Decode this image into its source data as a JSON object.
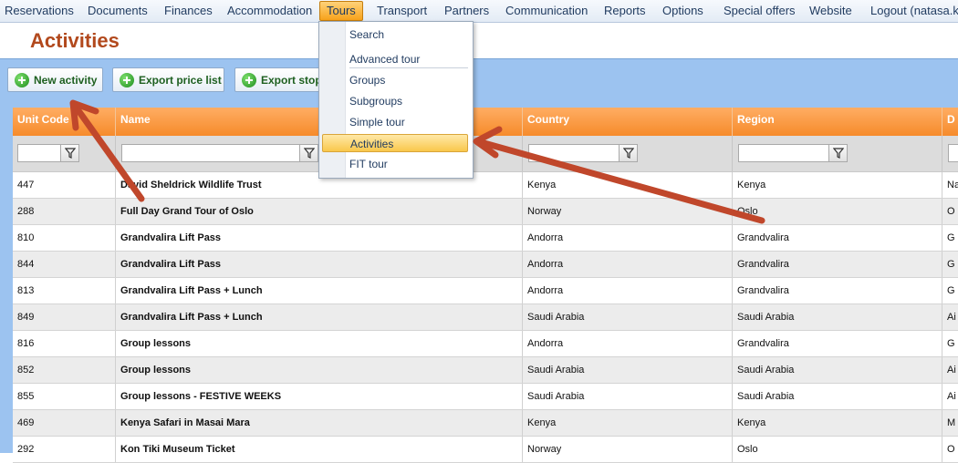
{
  "menu": {
    "items": [
      {
        "label": "Reservations"
      },
      {
        "label": "Documents"
      },
      {
        "label": "Finances"
      },
      {
        "label": "Accommodation"
      },
      {
        "label": "Tours"
      },
      {
        "label": "Transport"
      },
      {
        "label": "Partners"
      },
      {
        "label": "Communication"
      },
      {
        "label": "Reports"
      },
      {
        "label": "Options"
      },
      {
        "label": "Special offers"
      },
      {
        "label": "Website"
      },
      {
        "label": "Logout (natasa.kap"
      }
    ],
    "active": "Tours"
  },
  "page": {
    "title": "Activities"
  },
  "toolbar": {
    "new_activity": "New activity",
    "export_price_list": "Export price list",
    "export_stop": "Export stop"
  },
  "table": {
    "headers": [
      "Unit Code",
      "Name",
      "Country",
      "Region",
      "D"
    ],
    "rows": [
      [
        "447",
        "David Sheldrick Wildlife Trust",
        "Kenya",
        "Kenya",
        "Na"
      ],
      [
        "288",
        "Full Day Grand Tour of Oslo",
        "Norway",
        "Oslo",
        "O"
      ],
      [
        "810",
        "Grandvalira Lift Pass",
        "Andorra",
        "Grandvalira",
        "G"
      ],
      [
        "844",
        "Grandvalira Lift Pass",
        "Andorra",
        "Grandvalira",
        "G"
      ],
      [
        "813",
        "Grandvalira Lift Pass + Lunch",
        "Andorra",
        "Grandvalira",
        "G"
      ],
      [
        "849",
        "Grandvalira Lift Pass + Lunch",
        "Saudi Arabia",
        "Saudi Arabia",
        "Ai"
      ],
      [
        "816",
        "Group lessons",
        "Andorra",
        "Grandvalira",
        "G"
      ],
      [
        "852",
        "Group lessons",
        "Saudi Arabia",
        "Saudi Arabia",
        "Ai"
      ],
      [
        "855",
        "Group lessons - FESTIVE WEEKS",
        "Saudi Arabia",
        "Saudi Arabia",
        "Ai"
      ],
      [
        "469",
        "Kenya Safari in Masai Mara",
        "Kenya",
        "Kenya",
        "M"
      ],
      [
        "292",
        "Kon Tiki Museum Ticket",
        "Norway",
        "Oslo",
        "O"
      ]
    ]
  },
  "tours_menu": {
    "items": [
      "Search",
      "Advanced tour",
      "Groups",
      "Subgroups",
      "Simple tour",
      "Activities",
      "FIT tour"
    ],
    "selected": "Activities"
  },
  "colors": {
    "accent_orange": "#f68b2b",
    "title_color": "#b2491d",
    "arrow_color": "#c0472b",
    "toolbar_blue": "#9cc3f0"
  }
}
